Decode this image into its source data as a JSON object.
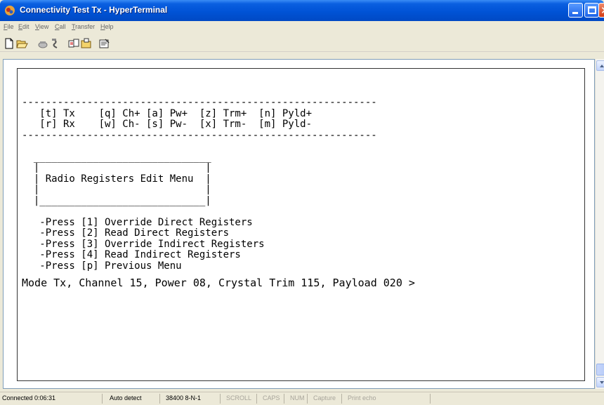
{
  "window": {
    "title": "Connectivity Test Tx - HyperTerminal"
  },
  "menu": [
    "File",
    "Edit",
    "View",
    "Call",
    "Transfer",
    "Help"
  ],
  "toolbar_icons": [
    "new-icon",
    "open-icon",
    "phone-icon",
    "disconnect-icon",
    "send-icon",
    "receive-icon",
    "properties-icon"
  ],
  "terminal": {
    "lines": [
      "",
      "",
      "------------------------------------------------------------",
      "   [t] Tx    [q] Ch+ [a] Pw+  [z] Trm+  [n] Pyld+",
      "   [r] Rx    [w] Ch- [s] Pw-  [x] Trm-  [m] Pyld-",
      "------------------------------------------------------------",
      "",
      "  ______________________________",
      "  |                            |",
      "  | Radio Registers Edit Menu  |",
      "  |                            |",
      "  |____________________________|",
      "",
      "   -Press [1] Override Direct Registers",
      "   -Press [2] Read Direct Registers",
      "   -Press [3] Override Indirect Registers",
      "   -Press [4] Read Indirect Registers",
      "   -Press [p] Previous Menu"
    ],
    "prompt": "Mode Tx, Channel 15, Power 08, Crystal Trim 115, Payload 020 >"
  },
  "status": {
    "connected": "Connected 0:06:31",
    "detect": "Auto detect",
    "port": "38400 8-N-1",
    "scroll": "SCROLL",
    "caps": "CAPS",
    "num": "NUM",
    "capture": "Capture",
    "print_echo": "Print echo"
  }
}
